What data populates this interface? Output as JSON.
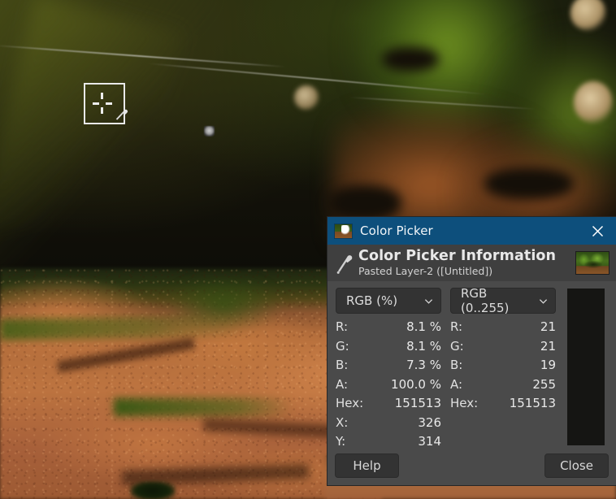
{
  "dialog": {
    "titlebar": {
      "icon": "gimp-wilber-icon",
      "title": "Color Picker",
      "close_icon": "close-icon"
    },
    "header": {
      "icon": "eyedropper-icon",
      "title": "Color Picker Information",
      "subtitle": "Pasted Layer-2 ([Untitled])",
      "thumbnail": "image-thumbnail"
    },
    "selectors": [
      {
        "name": "color-model-percent",
        "value": "RGB (%)",
        "icon": "chevron-down-icon"
      },
      {
        "name": "color-model-255",
        "value": "RGB (0..255)",
        "icon": "chevron-down-icon"
      }
    ],
    "swatch": {
      "name": "picked-color-swatch",
      "color": "#151513"
    },
    "percent_values": [
      {
        "label": "R:",
        "value": "8.1 %"
      },
      {
        "label": "G:",
        "value": "8.1 %"
      },
      {
        "label": "B:",
        "value": "7.3 %"
      },
      {
        "label": "A:",
        "value": "100.0 %"
      },
      {
        "label": "Hex:",
        "value": "151513"
      },
      {
        "label": "X:",
        "value": "326"
      },
      {
        "label": "Y:",
        "value": "314"
      }
    ],
    "byte_values": [
      {
        "label": "R:",
        "value": "21"
      },
      {
        "label": "G:",
        "value": "21"
      },
      {
        "label": "B:",
        "value": "19"
      },
      {
        "label": "A:",
        "value": "255"
      },
      {
        "label": "Hex:",
        "value": "151513"
      }
    ],
    "footer": {
      "help_label": "Help",
      "close_label": "Close"
    },
    "colors": {
      "titlebar_bg": "#0d4f7c",
      "dialog_bg": "#4a4a4a",
      "header_bg": "#3f3f3f",
      "button_bg": "#333333",
      "text": "#e8e8e8"
    }
  },
  "canvas": {
    "picker_cursor": "eyedropper-crosshair-cursor",
    "sample_marker": "sampled-pixel-marker"
  }
}
